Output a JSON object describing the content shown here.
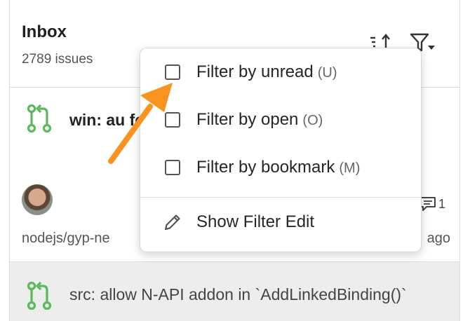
{
  "header": {
    "title": "Inbox",
    "count": "2789 issues"
  },
  "icons": {
    "sort": "sort-icon",
    "filter": "filter-icon",
    "pull_request": "pull-request-icon",
    "comment": "comment-icon",
    "pencil": "pencil-icon"
  },
  "colors": {
    "pr_icon": "#5cb85c",
    "arrow": "#f7931e"
  },
  "items": [
    {
      "title": "win: au for Win",
      "comments": "1",
      "repo": "nodejs/gyp-ne",
      "time": "ago"
    },
    {
      "title": "src: allow N-API addon in `AddLinkedBinding()`"
    }
  ],
  "filter_menu": {
    "items": [
      {
        "label": "Filter by unread",
        "shortcut": "(U)",
        "checked": false
      },
      {
        "label": "Filter by open",
        "shortcut": "(O)",
        "checked": false
      },
      {
        "label": "Filter by bookmark",
        "shortcut": "(M)",
        "checked": false
      }
    ],
    "edit_label": "Show Filter Edit"
  }
}
